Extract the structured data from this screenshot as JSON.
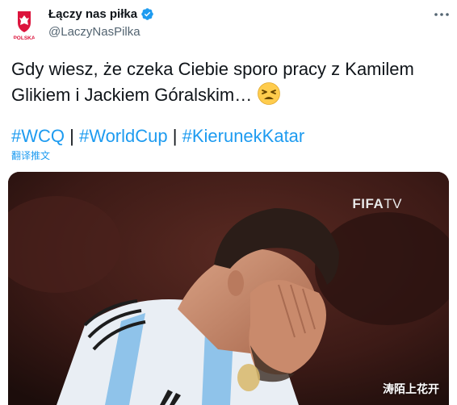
{
  "account": {
    "display_name": "Łączy nas piłka",
    "handle": "@LaczyNasPilka",
    "avatar_text": "POLSKA"
  },
  "tweet": {
    "text": "Gdy wiesz, że czeka Ciebie sporo pracy z Kamilem Glikiem i Jackiem Góralskim…",
    "emoji": "tired-face-emoji",
    "hashtags": [
      "#WCQ",
      "#WorldCup",
      "#KierunekKatar"
    ],
    "separator": "|",
    "translate_label": "翻译推文"
  },
  "media": {
    "broadcaster_logo": "FIFA TV",
    "logo_bold": "FIFA",
    "logo_light": "TV",
    "watermark": "涛陌上花开"
  },
  "colors": {
    "link": "#1d9bf0",
    "text": "#0f1419",
    "secondary": "#536471",
    "verified": "#1d9bf0",
    "polska_red": "#dc143c"
  }
}
